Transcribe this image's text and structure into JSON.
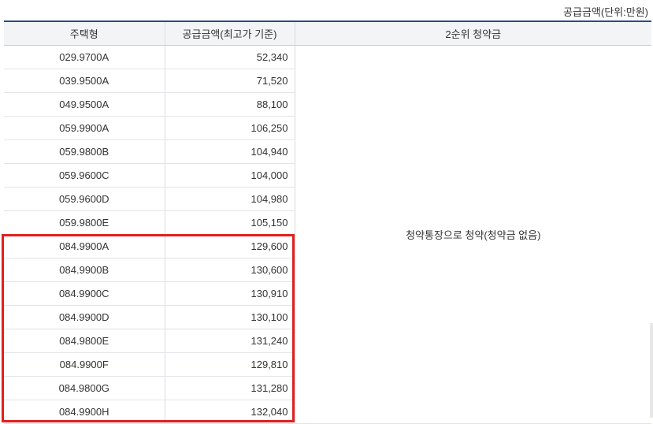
{
  "unit_note": "공급금액(단위:만원)",
  "table": {
    "headers": [
      "주택형",
      "공급금액(최고가 기준)",
      "2순위 청약금"
    ],
    "rows": [
      {
        "type": "029.9700A",
        "amount": "52,340"
      },
      {
        "type": "039.9500A",
        "amount": "71,520"
      },
      {
        "type": "049.9500A",
        "amount": "88,100"
      },
      {
        "type": "059.9900A",
        "amount": "106,250"
      },
      {
        "type": "059.9800B",
        "amount": "104,940"
      },
      {
        "type": "059.9600C",
        "amount": "104,000"
      },
      {
        "type": "059.9600D",
        "amount": "104,980"
      },
      {
        "type": "059.9800E",
        "amount": "105,150"
      },
      {
        "type": "084.9900A",
        "amount": "129,600"
      },
      {
        "type": "084.9900B",
        "amount": "130,600"
      },
      {
        "type": "084.9900C",
        "amount": "130,910"
      },
      {
        "type": "084.9900D",
        "amount": "130,100"
      },
      {
        "type": "084.9800E",
        "amount": "131,240"
      },
      {
        "type": "084.9900F",
        "amount": "129,810"
      },
      {
        "type": "084.9800G",
        "amount": "131,280"
      },
      {
        "type": "084.9900H",
        "amount": "132,040"
      }
    ],
    "deposit_text": "청약통장으로 청약(청약금 없음)"
  },
  "colors": {
    "header_top_border": "#2b4a8a",
    "highlight_border": "#e02020",
    "header_bg": "#f3f4f6"
  }
}
